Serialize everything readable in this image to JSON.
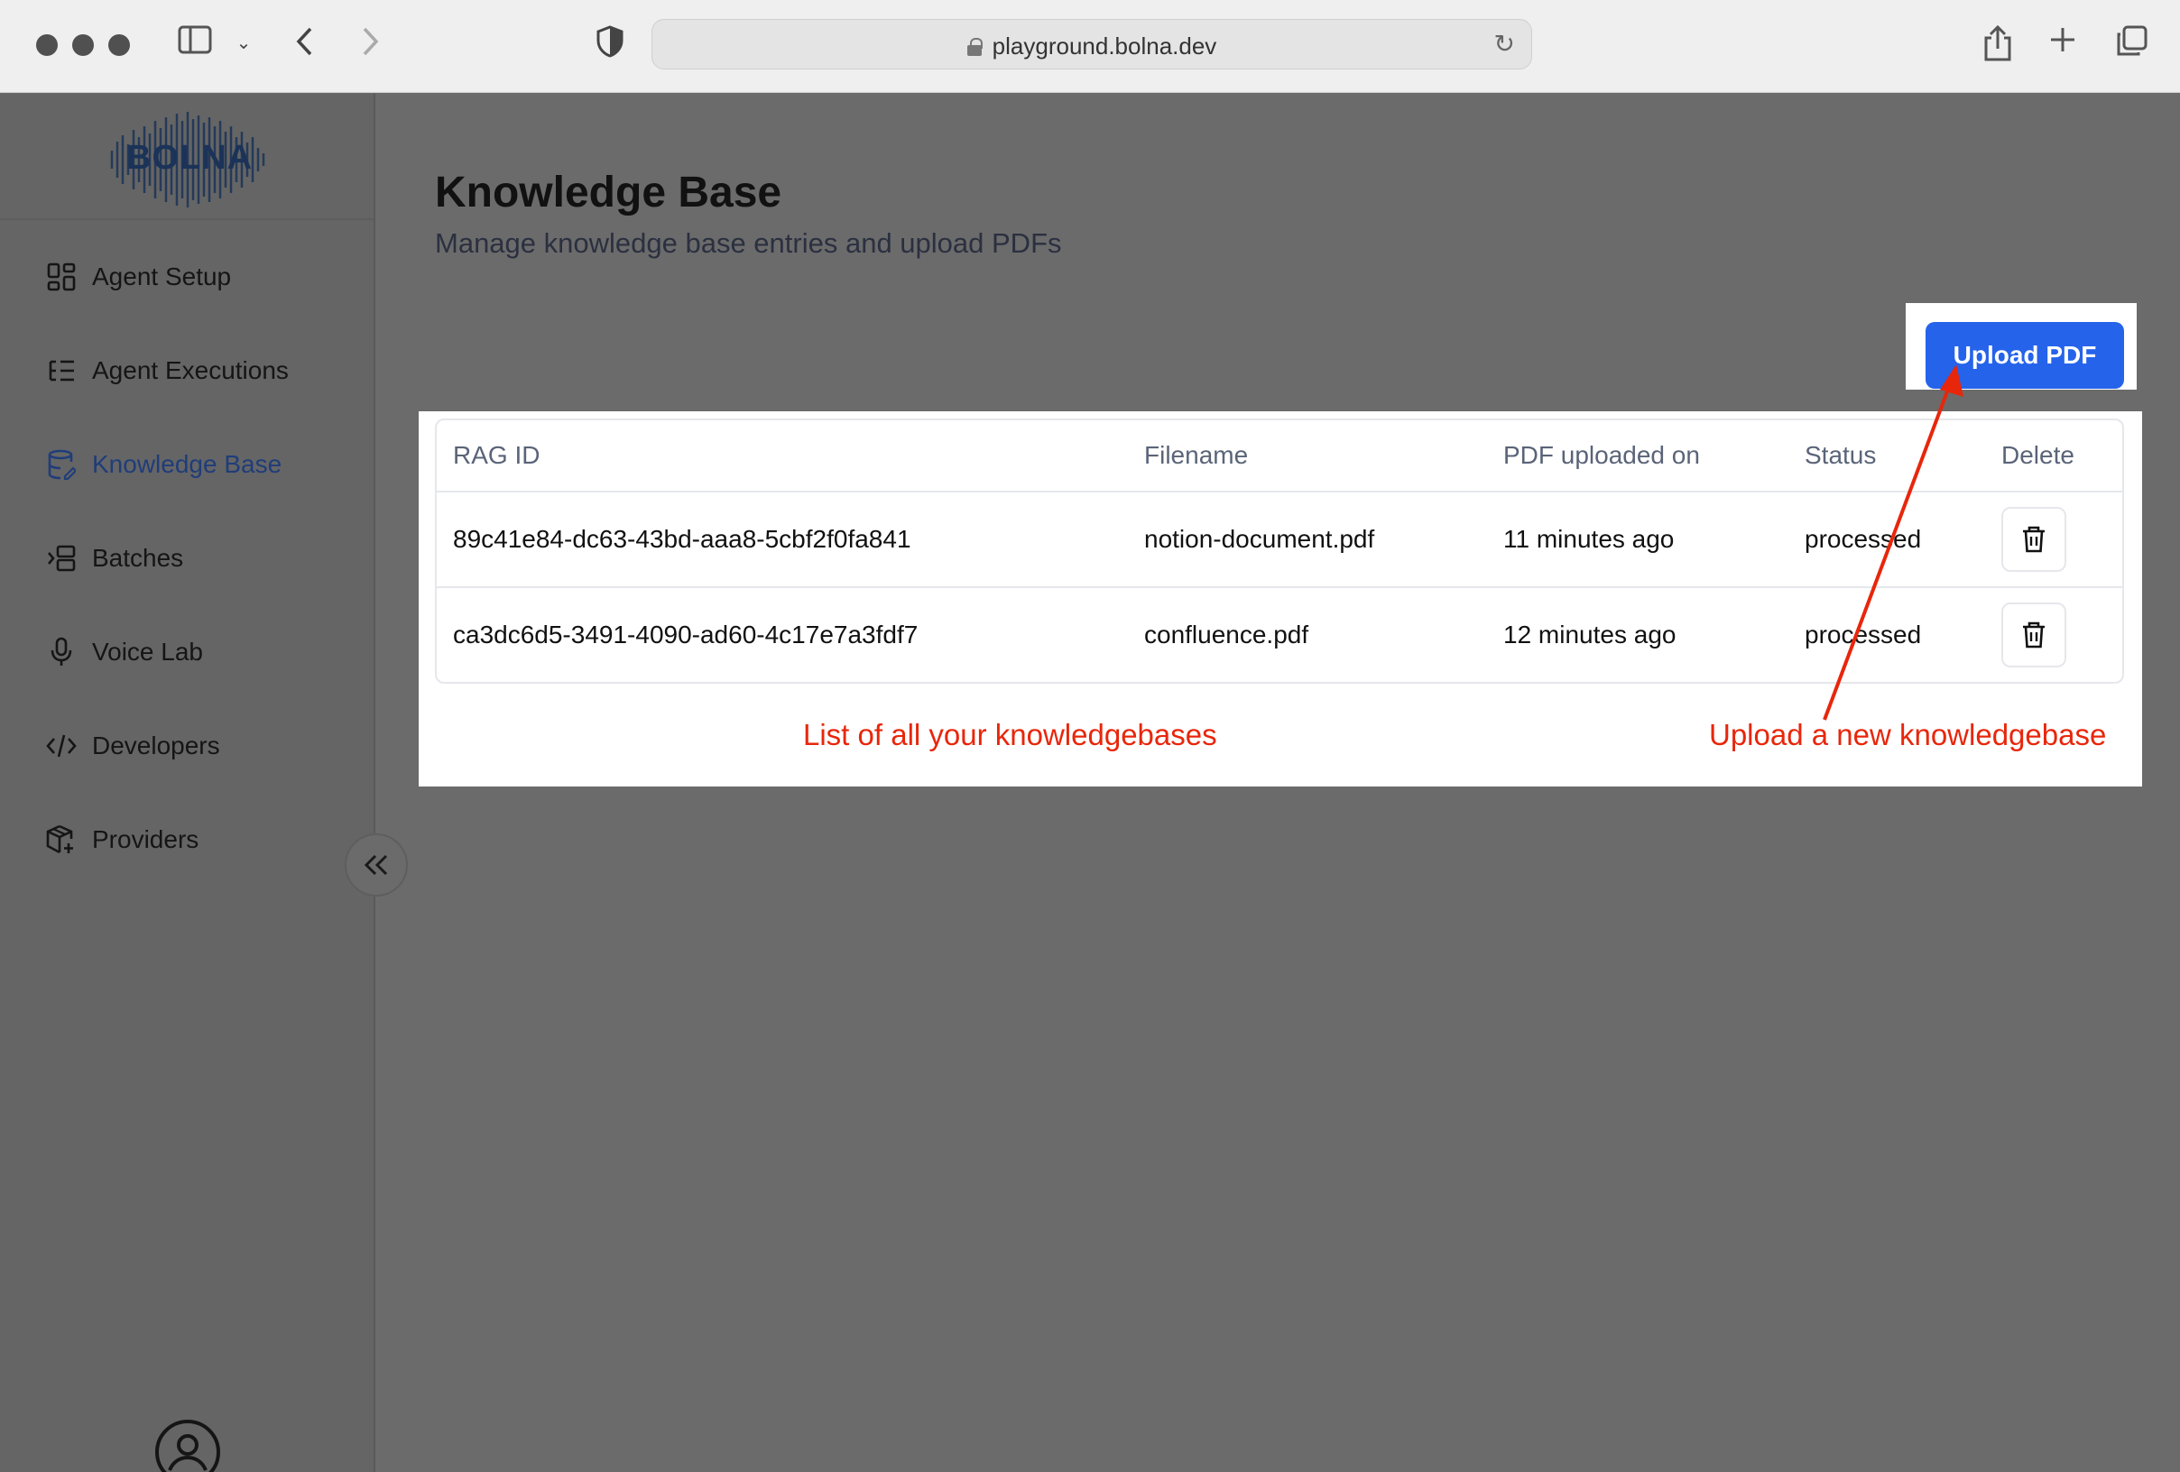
{
  "browser": {
    "url": "playground.bolna.dev"
  },
  "sidebar": {
    "logo": "BOLNA",
    "items": [
      {
        "label": "Agent Setup",
        "icon": "grid-icon"
      },
      {
        "label": "Agent Executions",
        "icon": "list-icon"
      },
      {
        "label": "Knowledge Base",
        "icon": "database-icon",
        "active": true
      },
      {
        "label": "Batches",
        "icon": "batches-icon"
      },
      {
        "label": "Voice Lab",
        "icon": "microphone-icon"
      },
      {
        "label": "Developers",
        "icon": "code-icon"
      },
      {
        "label": "Providers",
        "icon": "package-icon"
      }
    ]
  },
  "main": {
    "title": "Knowledge Base",
    "subtitle": "Manage knowledge base entries and upload PDFs",
    "upload_label": "Upload PDF",
    "table": {
      "headers": [
        "RAG ID",
        "Filename",
        "PDF uploaded on",
        "Status",
        "Delete"
      ],
      "rows": [
        {
          "rag_id": "89c41e84-dc63-43bd-aaa8-5cbf2f0fa841",
          "filename": "notion-document.pdf",
          "uploaded": "11 minutes ago",
          "status": "processed"
        },
        {
          "rag_id": "ca3dc6d5-3491-4090-ad60-4c17e7a3fdf7",
          "filename": "confluence.pdf",
          "uploaded": "12 minutes ago",
          "status": "processed"
        }
      ]
    }
  },
  "annotations": {
    "list_note": "List of all your knowledgebases",
    "upload_note": "Upload a new knowledgebase",
    "color": "#e8260b"
  },
  "colors": {
    "accent": "#2563eb"
  }
}
